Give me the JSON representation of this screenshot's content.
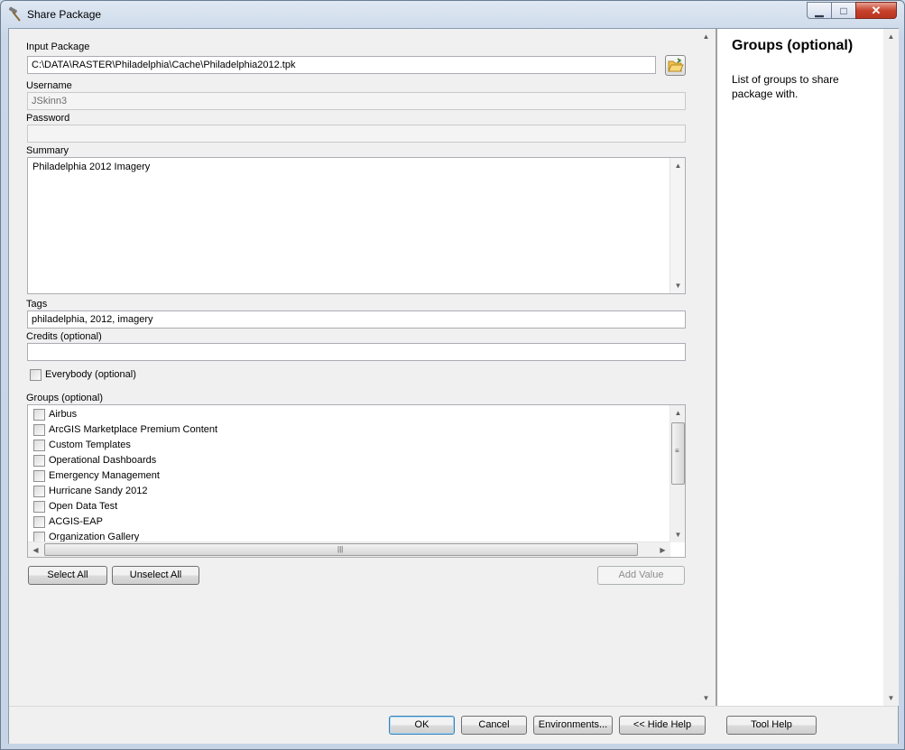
{
  "window": {
    "title": "Share Package",
    "controls": {
      "minimize": "▁",
      "maximize": "□",
      "close": "✕"
    }
  },
  "form": {
    "input_package": {
      "label": "Input Package",
      "value": "C:\\DATA\\RASTER\\Philadelphia\\Cache\\Philadelphia2012.tpk"
    },
    "username": {
      "label": "Username",
      "value": "JSkinn3"
    },
    "password": {
      "label": "Password",
      "value": ""
    },
    "summary": {
      "label": "Summary",
      "value": "Philadelphia 2012 Imagery"
    },
    "tags": {
      "label": "Tags",
      "value": "philadelphia, 2012, imagery"
    },
    "credits": {
      "label": "Credits (optional)",
      "value": ""
    },
    "everybody": {
      "label": "Everybody (optional)",
      "checked": false
    },
    "groups": {
      "label": "Groups (optional)",
      "items": [
        "Airbus",
        "ArcGIS Marketplace Premium Content",
        "Custom Templates",
        "Operational Dashboards",
        "Emergency Management",
        "Hurricane Sandy 2012",
        "Open Data Test",
        "ACGIS-EAP",
        "Organization Gallery"
      ]
    },
    "buttons": {
      "select_all": "Select All",
      "unselect_all": "Unselect All",
      "add_value": "Add Value"
    }
  },
  "help": {
    "title": "Groups (optional)",
    "text": "List of groups to share package with."
  },
  "bottom_buttons": {
    "ok": "OK",
    "cancel": "Cancel",
    "environments": "Environments...",
    "hide_help": "<< Hide Help",
    "tool_help": "Tool Help"
  },
  "icons": {
    "window": "hammer-icon",
    "browse": "folder-open-icon",
    "colors": {
      "folder": "#f2c14e",
      "title_bar": "#c9d7e8",
      "close_button": "#c7442d"
    }
  }
}
